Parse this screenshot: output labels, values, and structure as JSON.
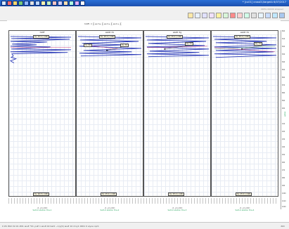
{
  "window": {
    "title": "* [cu01] cross01/targetA 6/07/2017"
  },
  "toolbar_status": "0DEG  00000 stopped",
  "equation": "hdiff· = ∑ ex·h+ ∑ ex·h+ ∑ ex·h+ ∑",
  "panels": [
    {
      "head": "hdiff",
      "top_box": "0+ 15.1 (-odd)",
      "bottom_box": "0+ 16.3 (-odd)",
      "axis_n": "-6 +hs(90)",
      "axis_t": "Salt-0 station tha-1"
    },
    {
      "head": "abdlt 31",
      "top_box": "0+ 15.1 (-odd)",
      "bottom_box": "0+ 15.1 (-odd)",
      "axis_n": "-6 +hs(90)",
      "axis_t": "Salt-0 station tha-2"
    },
    {
      "head": "abdlt 3g",
      "top_box": "0+ 15.1 (-odd)",
      "bottom_box": "0+ 15.1 (-odd)",
      "axis_n": "-6 +hs(90)",
      "axis_t": "Salt-0 station tha-3"
    },
    {
      "head": "abdlt 31",
      "top_box": "0+ 15.1 (-odd)",
      "bottom_box": "0+ 15.1 (-odd)",
      "axis_n": "-6 +hs(90)",
      "axis_t": "Salt-0 station tha-4"
    }
  ],
  "annotations": {
    "p2_left": "0+ 60",
    "p2_right": "0+ 70",
    "p3_right": "0+ 71",
    "p4_right": "0+ 73"
  },
  "right_axis": {
    "ticks": [
      "800",
      "810",
      "820",
      "830",
      "840",
      "850",
      "860",
      "870",
      "880",
      "890",
      "900",
      "910",
      "920",
      "930",
      "940",
      "950",
      "960",
      "970",
      "980",
      "990",
      "1000",
      "1010",
      "1020"
    ],
    "label": "depth"
  },
  "status": {
    "text": "0 #1   802.32.01  #01 wu#  *01 yu#   1 wu#.02 bar0  ~1/y(0) wu#   10 mxy1   0001 0 wyoe opr1",
    "right": "dbh"
  },
  "colors": {
    "curve": "#2a3ab8",
    "accent_line": "#c8387a",
    "accent_line2": "#3aa46b"
  }
}
